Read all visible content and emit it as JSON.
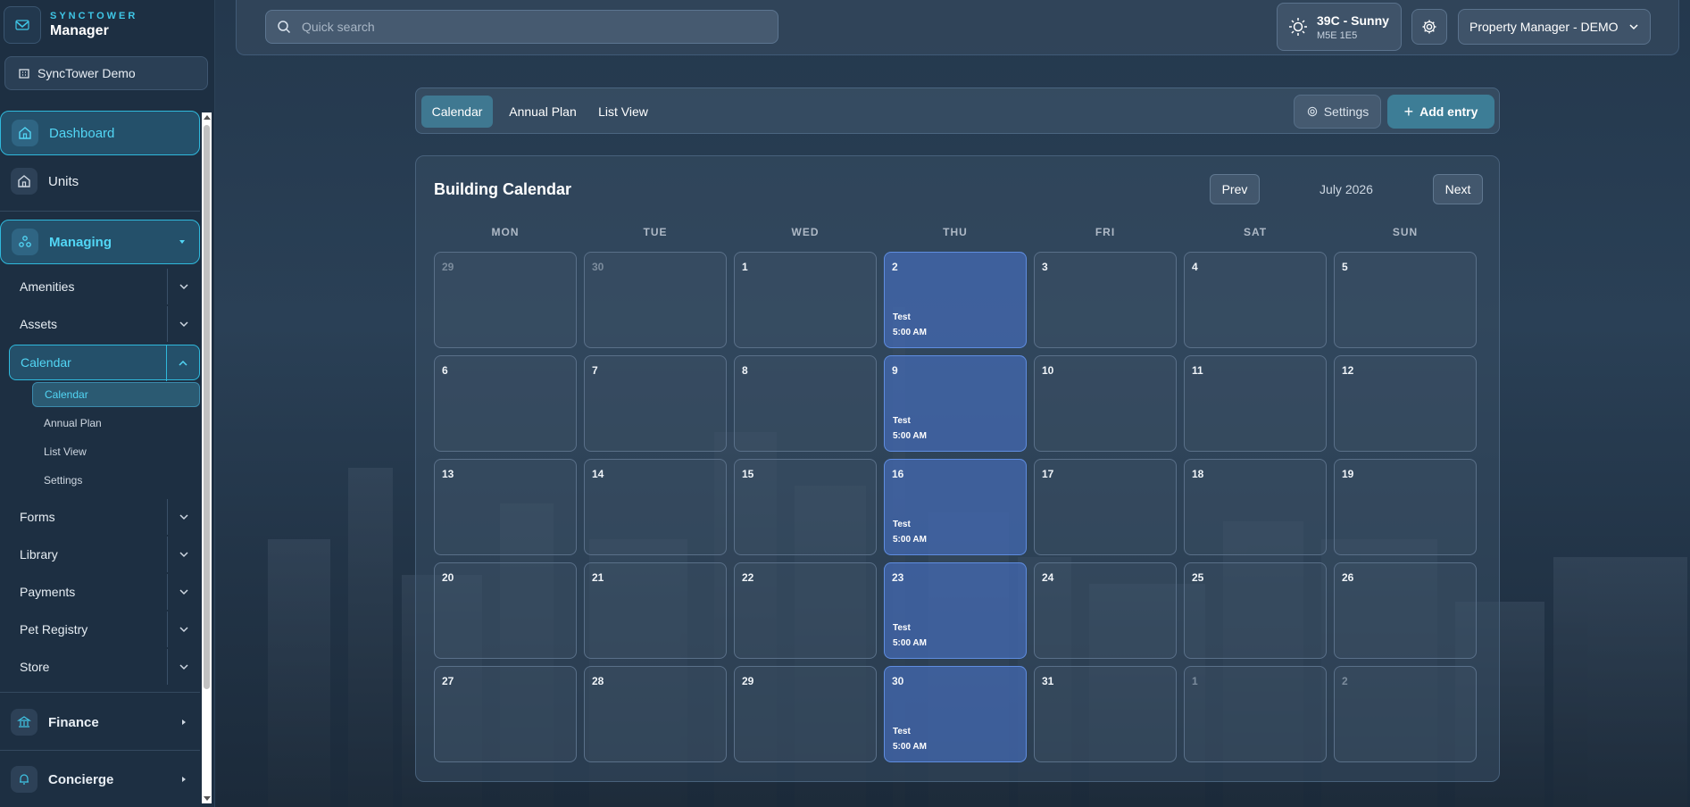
{
  "brand": {
    "sub": "SYNCTOWER",
    "main": "Manager"
  },
  "org": {
    "name": "SyncTower Demo"
  },
  "sidebar": {
    "dashboard": "Dashboard",
    "units": "Units",
    "managing": "Managing",
    "groups": [
      "Amenities",
      "Assets",
      "Calendar",
      "Forms",
      "Library",
      "Payments",
      "Pet Registry",
      "Store"
    ],
    "calendar_sub": [
      "Calendar",
      "Annual Plan",
      "List View",
      "Settings"
    ],
    "finance": "Finance",
    "concierge": "Concierge"
  },
  "topbar": {
    "search_placeholder": "Quick search",
    "weather_temp": "39C - Sunny",
    "weather_postal": "M5E 1E5",
    "user": "Property Manager - DEMO"
  },
  "tabs": {
    "calendar": "Calendar",
    "annual": "Annual Plan",
    "list": "List View",
    "settings": "Settings",
    "add": "Add entry"
  },
  "calendar": {
    "title": "Building Calendar",
    "prev": "Prev",
    "next": "Next",
    "month": "July 2026",
    "weekdays": [
      "MON",
      "TUE",
      "WED",
      "THU",
      "FRI",
      "SAT",
      "SUN"
    ],
    "days": [
      {
        "n": "29",
        "other": true
      },
      {
        "n": "30",
        "other": true
      },
      {
        "n": "1"
      },
      {
        "n": "2",
        "event": "Test",
        "time": "5:00 AM"
      },
      {
        "n": "3"
      },
      {
        "n": "4"
      },
      {
        "n": "5"
      },
      {
        "n": "6"
      },
      {
        "n": "7"
      },
      {
        "n": "8"
      },
      {
        "n": "9",
        "event": "Test",
        "time": "5:00 AM"
      },
      {
        "n": "10"
      },
      {
        "n": "11"
      },
      {
        "n": "12"
      },
      {
        "n": "13"
      },
      {
        "n": "14"
      },
      {
        "n": "15"
      },
      {
        "n": "16",
        "event": "Test",
        "time": "5:00 AM"
      },
      {
        "n": "17"
      },
      {
        "n": "18"
      },
      {
        "n": "19"
      },
      {
        "n": "20"
      },
      {
        "n": "21"
      },
      {
        "n": "22"
      },
      {
        "n": "23",
        "event": "Test",
        "time": "5:00 AM"
      },
      {
        "n": "24"
      },
      {
        "n": "25"
      },
      {
        "n": "26"
      },
      {
        "n": "27"
      },
      {
        "n": "28"
      },
      {
        "n": "29"
      },
      {
        "n": "30",
        "event": "Test",
        "time": "5:00 AM"
      },
      {
        "n": "31"
      },
      {
        "n": "1",
        "other": true
      },
      {
        "n": "2",
        "other": true
      }
    ]
  },
  "colors": {
    "accent": "#52d6f5",
    "event_bg": "#4a6ebe",
    "primary_btn": "#3d7d96"
  }
}
